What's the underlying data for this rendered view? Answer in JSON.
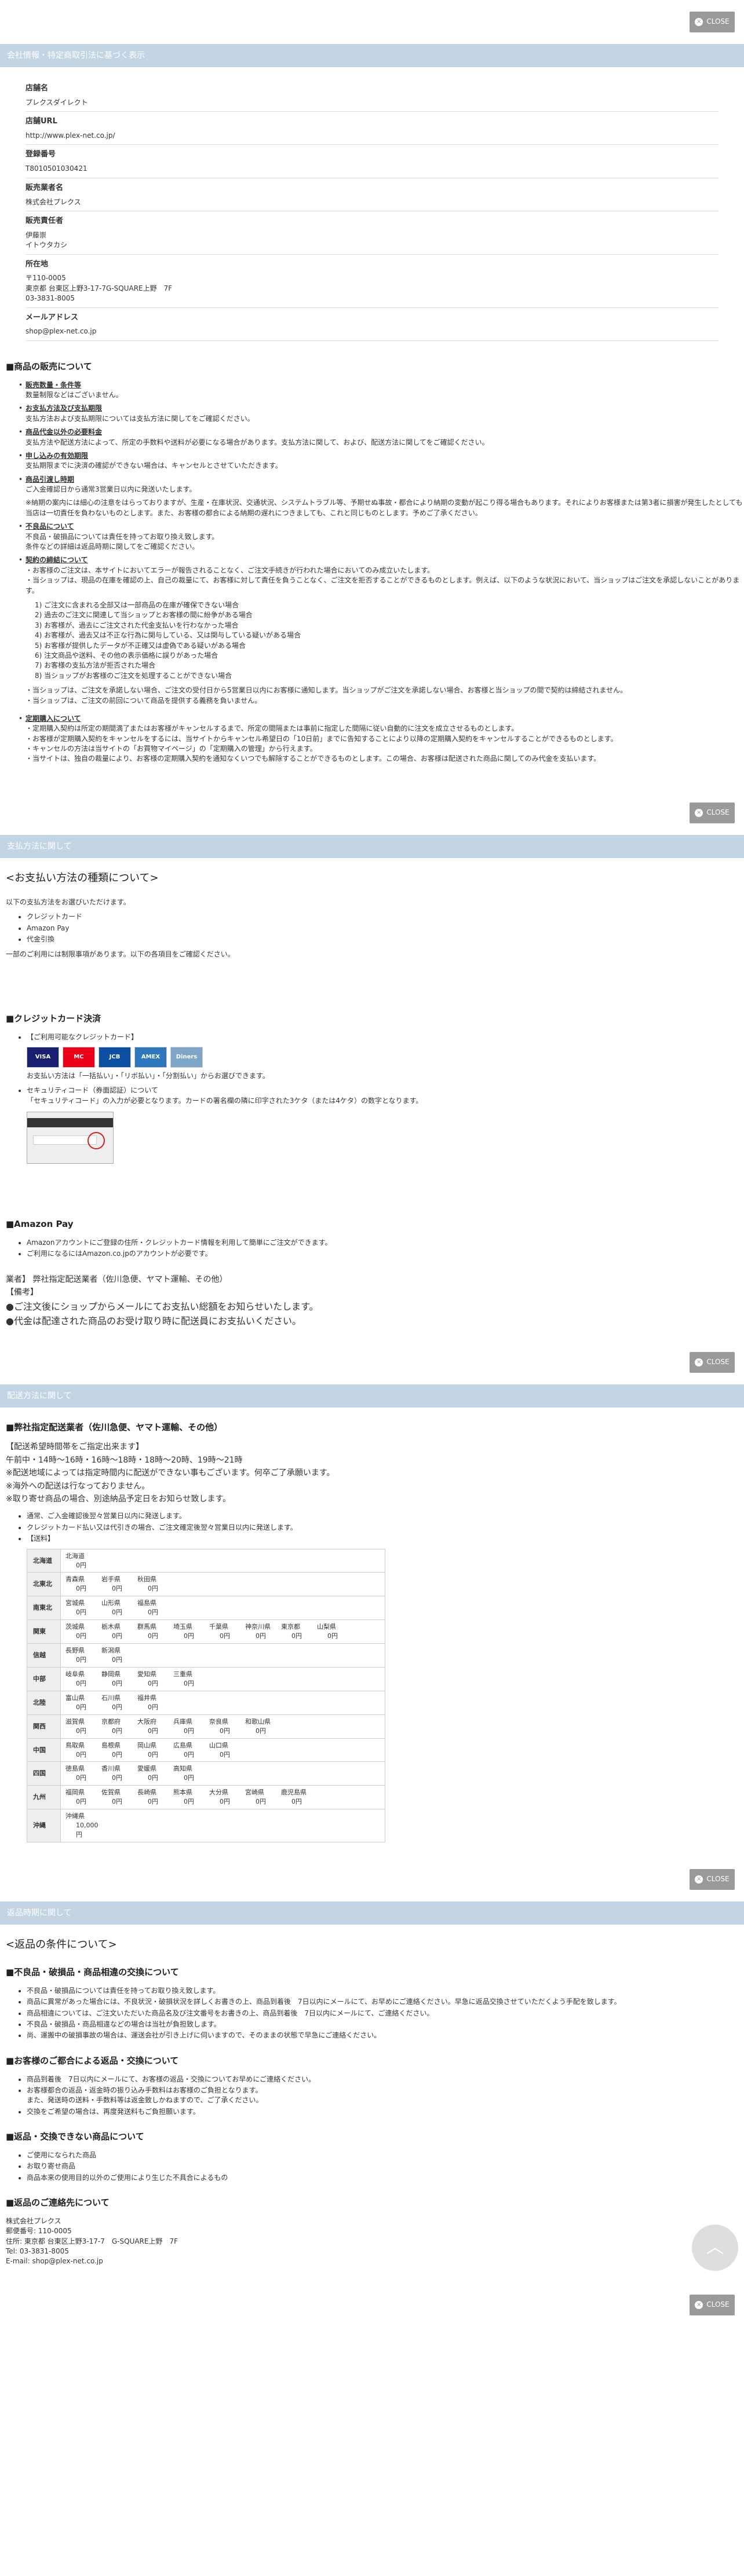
{
  "close_label": "CLOSE",
  "company": {
    "title": "会社情報・特定商取引法に基づく表示",
    "rows": [
      {
        "label": "店舗名",
        "value": "プレクスダイレクト"
      },
      {
        "label": "店舗URL",
        "value": "http://www.plex-net.co.jp/"
      },
      {
        "label": "登録番号",
        "value": "T8010501030421"
      },
      {
        "label": "販売業者名",
        "value": "株式会社プレクス"
      },
      {
        "label": "販売責任者",
        "value": "伊藤崇\nイトウタカシ"
      },
      {
        "label": "所在地",
        "value": "〒110-0005\n東京都 台東区上野3-17-7G-SQUARE上野　7F\n03-3831-8005"
      },
      {
        "label": "メールアドレス",
        "value": "shop@plex-net.co.jp"
      }
    ]
  },
  "sales": {
    "title": "■商品の販売について",
    "items": [
      {
        "t": "販売数量・条件等",
        "d": "数量制限などはございません。"
      },
      {
        "t": "お支払方法及び支払期限",
        "d": "支払方法および支払期限については支払方法に関してをご確認ください。"
      },
      {
        "t": "商品代金以外の必要料金",
        "d": "支払方法や配送方法によって、所定の手数料や送料が必要になる場合があります。支払方法に関して、および、配送方法に関してをご確認ください。"
      },
      {
        "t": "申し込みの有効期限",
        "d": "支払期限までに決済の確認ができない場合は、キャンセルとさせていただきます。"
      },
      {
        "t": "商品引渡し時期",
        "d": "ご入金確認日から通常3営業日以内に発送いたします。"
      },
      {
        "t": "",
        "d": "※納期の案内には細心の注意をはらっておりますが、生産・在庫状況、交通状況、システムトラブル等、予期せぬ事故・都合により納期の変動が起こり得る場合もあります。それによりお客様または第3者に損害が発生したとしても当店は一切責任を負わないものとします。また、お客様の都合による納期の遅れにつきましても、これと同じものとします。予めご了承ください。"
      },
      {
        "t": "不良品について",
        "d": "不良品・破損品については責任を持ってお取り換え致します。\n条件などの詳細は返品時期に関してをご確認ください。"
      },
      {
        "t": "契約の締結について",
        "d": "・お客様のご注文は、本サイトにおいてエラーが報告されることなく、ご注文手続きが行われた場合においてのみ成立いたします。\n・当ショップは、現品の在庫を確認の上、自己の裁量にて、お客様に対して責任を負うことなく、ご注文を拒否することができるものとします。例えば、以下のような状況において、当ショップはご注文を承認しないことがあります。"
      }
    ],
    "reasons": [
      "1) ご注文に含まれる全部又は一部商品の在庫が確保できない場合",
      "2) 過去のご注文に関連して当ショップとお客様の間に紛争がある場合",
      "3) お客様が、過去にご注文された代金支払いを行わなかった場合",
      "4) お客様が、過去又は不正な行為に関与している、又は関与している疑いがある場合",
      "5) お客様が提供したデータが不正確又は虚偽である疑いがある場合",
      "6) 注文商品や送料、その他の表示価格に誤りがあった場合",
      "7) お客様の支払方法が拒否された場合",
      "8) 当ショップがお客様のご注文を処理することができない場合"
    ],
    "after": [
      "・当ショップは、ご注文を承諾しない場合、ご注文の受付日から5営業日以内にお客様に通知します。当ショップがご注文を承諾しない場合、お客様と当ショップの間で契約は締結されません。",
      "・当ショップは、ご注文の前回について商品を提供する義務を負いません。"
    ],
    "sub_title": "定期購入について",
    "sub": [
      "・定期購入契約は所定の期間満了またはお客様がキャンセルするまで、所定の間隔または事前に指定した間隔に従い自動的に注文を成立させるものとします。",
      "・お客様が定期購入契約をキャンセルをするには、当サイトからキャンセル希望日の「10日前」までに告知することにより以降の定期購入契約をキャンセルすることができるものとします。",
      "・キャンセルの方法は当サイトの「お買物マイページ」の「定期購入の管理」から行えます。",
      "・当サイトは、独自の裁量により、お客様の定期購入契約を通知なくいつでも解除することができるものとします。この場合、お客様は配送された商品に関してのみ代金を支払います。"
    ]
  },
  "payment": {
    "bar": "支払方法に関して",
    "h": "<お支払い方法の種類について>",
    "intro": "以下の支払方法をお選びいただけます。",
    "methods": [
      "クレジットカード",
      "Amazon Pay",
      "代金引換"
    ],
    "note": "一部のご利用には制限事項があります。以下の各項目をご確認ください。",
    "cc_title": "■クレジットカード決済",
    "cc_list": "【ご利用可能なクレジットカード】",
    "cards": [
      {
        "n": "VISA",
        "c": "#1a1f71"
      },
      {
        "n": "MC",
        "c": "#eb001b"
      },
      {
        "n": "JCB",
        "c": "#0b4ea2"
      },
      {
        "n": "AMEX",
        "c": "#2e77bc"
      },
      {
        "n": "Diners",
        "c": "#7fa6c9"
      }
    ],
    "cc_pay": "お支払い方法は「一括払い」・「リボ払い」・「分割払い」からお選びできます。",
    "cc_sec": "セキュリティコード（券面認証）について",
    "cc_sec2": "「セキュリティコード」の入力が必要となります。カードの署名欄の隣に印字された3ケタ（または4ケタ）の数字となります。",
    "amazon_title": "■Amazon Pay",
    "amazon": [
      "Amazonアカウントにご登録の住所・クレジットカード情報を利用して簡単にご注文ができます。",
      "ご利用になるにはAmazon.co.jpのアカウントが必要です。"
    ],
    "carrier": "業者】 弊社指定配送業者（佐川急便、ヤマト運輸、その他）",
    "remark": "【備考】",
    "r1": "●ご注文後にショップからメールにてお支払い総額をお知らせいたします。",
    "r2": "●代金は配達された商品のお受け取り時に配送員にお支払いください。"
  },
  "delivery": {
    "bar": "配送方法に関して",
    "h": "■弊社指定配送業者（佐川急便、ヤマト運輸、その他）",
    "lines": [
      "【配送希望時間帯をご指定出来ます】",
      "午前中・14時〜16時・16時〜18時・18時〜20時、19時〜21時",
      "※配送地域によっては指定時間内に配送ができない事もございます。何卒ご了承願います。",
      "※海外への配送は行なっておりません。",
      "※取り寄せ商品の場合、別途納品予定日をお知らせ致します。"
    ],
    "notes": [
      "通常、ご入金確認後翌々営業日以内に発送します。",
      "クレジットカード払い又は代引きの場合、ご注文確定後翌々営業日以内に発送します。",
      "【送料】"
    ],
    "rates": [
      {
        "r": "北海道",
        "p": [
          [
            "北海道",
            "0円"
          ]
        ]
      },
      {
        "r": "北東北",
        "p": [
          [
            "青森県",
            "0円"
          ],
          [
            "岩手県",
            "0円"
          ],
          [
            "秋田県",
            "0円"
          ]
        ]
      },
      {
        "r": "南東北",
        "p": [
          [
            "宮城県",
            "0円"
          ],
          [
            "山形県",
            "0円"
          ],
          [
            "福島県",
            "0円"
          ]
        ]
      },
      {
        "r": "関東",
        "p": [
          [
            "茨城県",
            "0円"
          ],
          [
            "栃木県",
            "0円"
          ],
          [
            "群馬県",
            "0円"
          ],
          [
            "埼玉県",
            "0円"
          ],
          [
            "千葉県",
            "0円"
          ],
          [
            "神奈川県",
            "0円"
          ],
          [
            "東京都",
            "0円"
          ],
          [
            "山梨県",
            "0円"
          ]
        ]
      },
      {
        "r": "信越",
        "p": [
          [
            "長野県",
            "0円"
          ],
          [
            "新潟県",
            "0円"
          ]
        ]
      },
      {
        "r": "中部",
        "p": [
          [
            "岐阜県",
            "0円"
          ],
          [
            "静岡県",
            "0円"
          ],
          [
            "愛知県",
            "0円"
          ],
          [
            "三重県",
            "0円"
          ]
        ]
      },
      {
        "r": "北陸",
        "p": [
          [
            "富山県",
            "0円"
          ],
          [
            "石川県",
            "0円"
          ],
          [
            "福井県",
            "0円"
          ]
        ]
      },
      {
        "r": "関西",
        "p": [
          [
            "滋賀県",
            "0円"
          ],
          [
            "京都府",
            "0円"
          ],
          [
            "大阪府",
            "0円"
          ],
          [
            "兵庫県",
            "0円"
          ],
          [
            "奈良県",
            "0円"
          ],
          [
            "和歌山県",
            "0円"
          ]
        ]
      },
      {
        "r": "中国",
        "p": [
          [
            "鳥取県",
            "0円"
          ],
          [
            "島根県",
            "0円"
          ],
          [
            "岡山県",
            "0円"
          ],
          [
            "広島県",
            "0円"
          ],
          [
            "山口県",
            "0円"
          ]
        ]
      },
      {
        "r": "四国",
        "p": [
          [
            "徳島県",
            "0円"
          ],
          [
            "香川県",
            "0円"
          ],
          [
            "愛媛県",
            "0円"
          ],
          [
            "高知県",
            "0円"
          ]
        ]
      },
      {
        "r": "九州",
        "p": [
          [
            "福岡県",
            "0円"
          ],
          [
            "佐賀県",
            "0円"
          ],
          [
            "長崎県",
            "0円"
          ],
          [
            "熊本県",
            "0円"
          ],
          [
            "大分県",
            "0円"
          ],
          [
            "宮崎県",
            "0円"
          ],
          [
            "鹿児島県",
            "0円"
          ]
        ]
      },
      {
        "r": "沖縄",
        "p": [
          [
            "沖縄県",
            "10,000円"
          ]
        ]
      }
    ]
  },
  "returns": {
    "bar": "返品時期に関して",
    "h": "<返品の条件について>",
    "s1": "■不良品・破損品・商品相違の交換について",
    "s1l": [
      "不良品・破損品については責任を持ってお取り換え致します。",
      "商品に異常があった場合には、不良状況・破損状況を詳しくお書きの上、商品到着後　7日以内にメールにて、お早めにご連絡ください。早急に返品交換させていただくよう手配を致します。",
      "商品相違については、ご注文いただいた商品名及び注文番号をお書きの上、商品到着後　7日以内にメールにて、ご連絡ください。",
      "不良品・破損品・商品相違などの場合は当社が負担致します。",
      "尚、運搬中の破損事故の場合は、運送会社が引き上げに伺いますので、そのままの状態で早急にご連絡ください。"
    ],
    "s2": "■お客様のご都合による返品・交換について",
    "s2l": [
      "商品到着後　7日以内にメールにて、お客様の返品・交換についてお早めにご連絡ください。",
      "お客様都合の返品・返金時の振り込み手数料はお客様のご負担となります。\nまた、発送時の送料・手数料等は返金致しかねますので、ご了承ください。",
      "交換をご希望の場合は、再度発送料もご負担願います。"
    ],
    "s3": "■返品・交換できない商品について",
    "s3l": [
      "ご使用になられた商品",
      "お取り寄せ商品",
      "商品本来の使用目的以外のご使用により生じた不具合によるもの"
    ],
    "s4": "■返品のご連絡先について",
    "contact": [
      "株式会社プレクス",
      "郵便番号: 110-0005",
      "住所: 東京都 台東区上野3-17-7　G-SQUARE上野　7F",
      "Tel: 03-3831-8005",
      "E-mail: shop@plex-net.co.jp"
    ]
  }
}
